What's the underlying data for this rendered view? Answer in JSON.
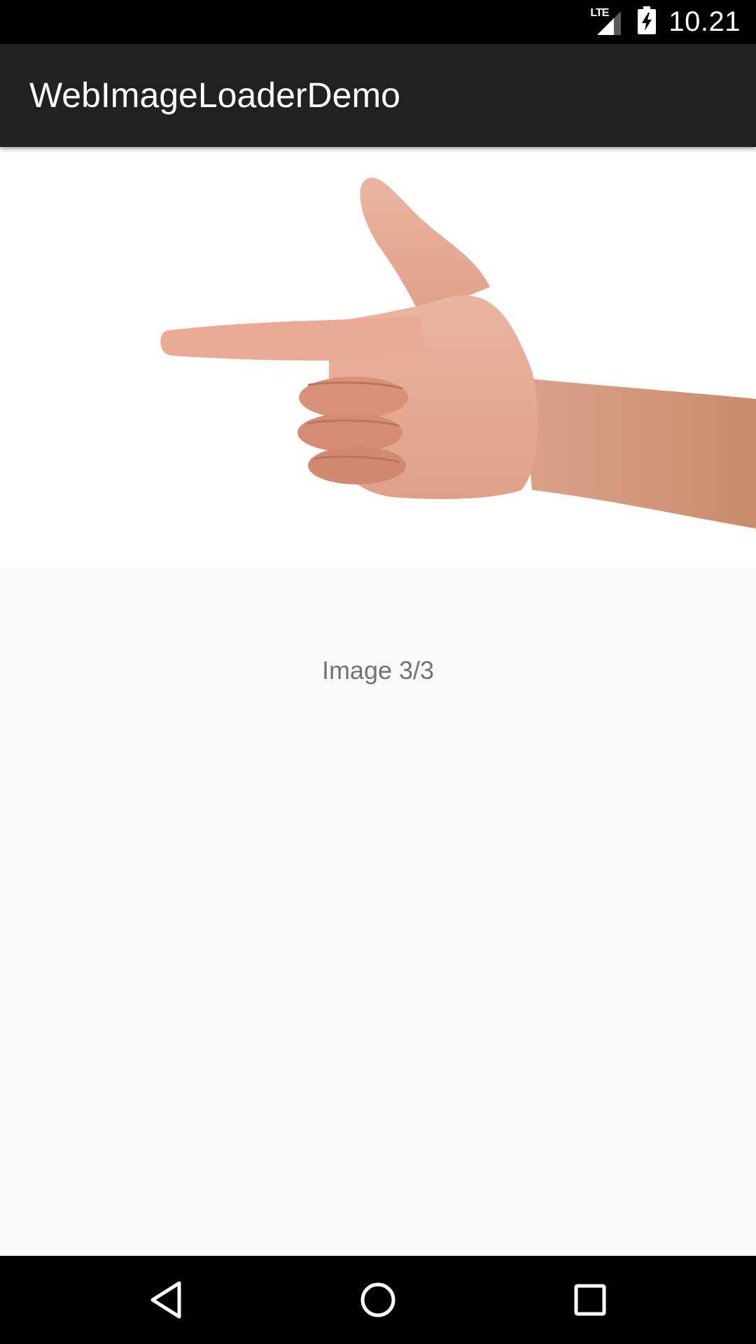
{
  "status_bar": {
    "network_label": "LTE",
    "time": "10.21",
    "icons": [
      "signal-icon",
      "battery-charging-icon"
    ]
  },
  "app_bar": {
    "title": "WebImageLoaderDemo"
  },
  "main": {
    "image_icon": "pointing-hand-image",
    "caption": "Image 3/3"
  },
  "nav_bar": {
    "icons": [
      "back-icon",
      "home-icon",
      "recents-icon"
    ]
  },
  "colors": {
    "status_bar": "#000000",
    "app_bar": "#212121",
    "background": "#f9f9f9",
    "caption_text": "#737373",
    "skin": "#e8a892"
  }
}
